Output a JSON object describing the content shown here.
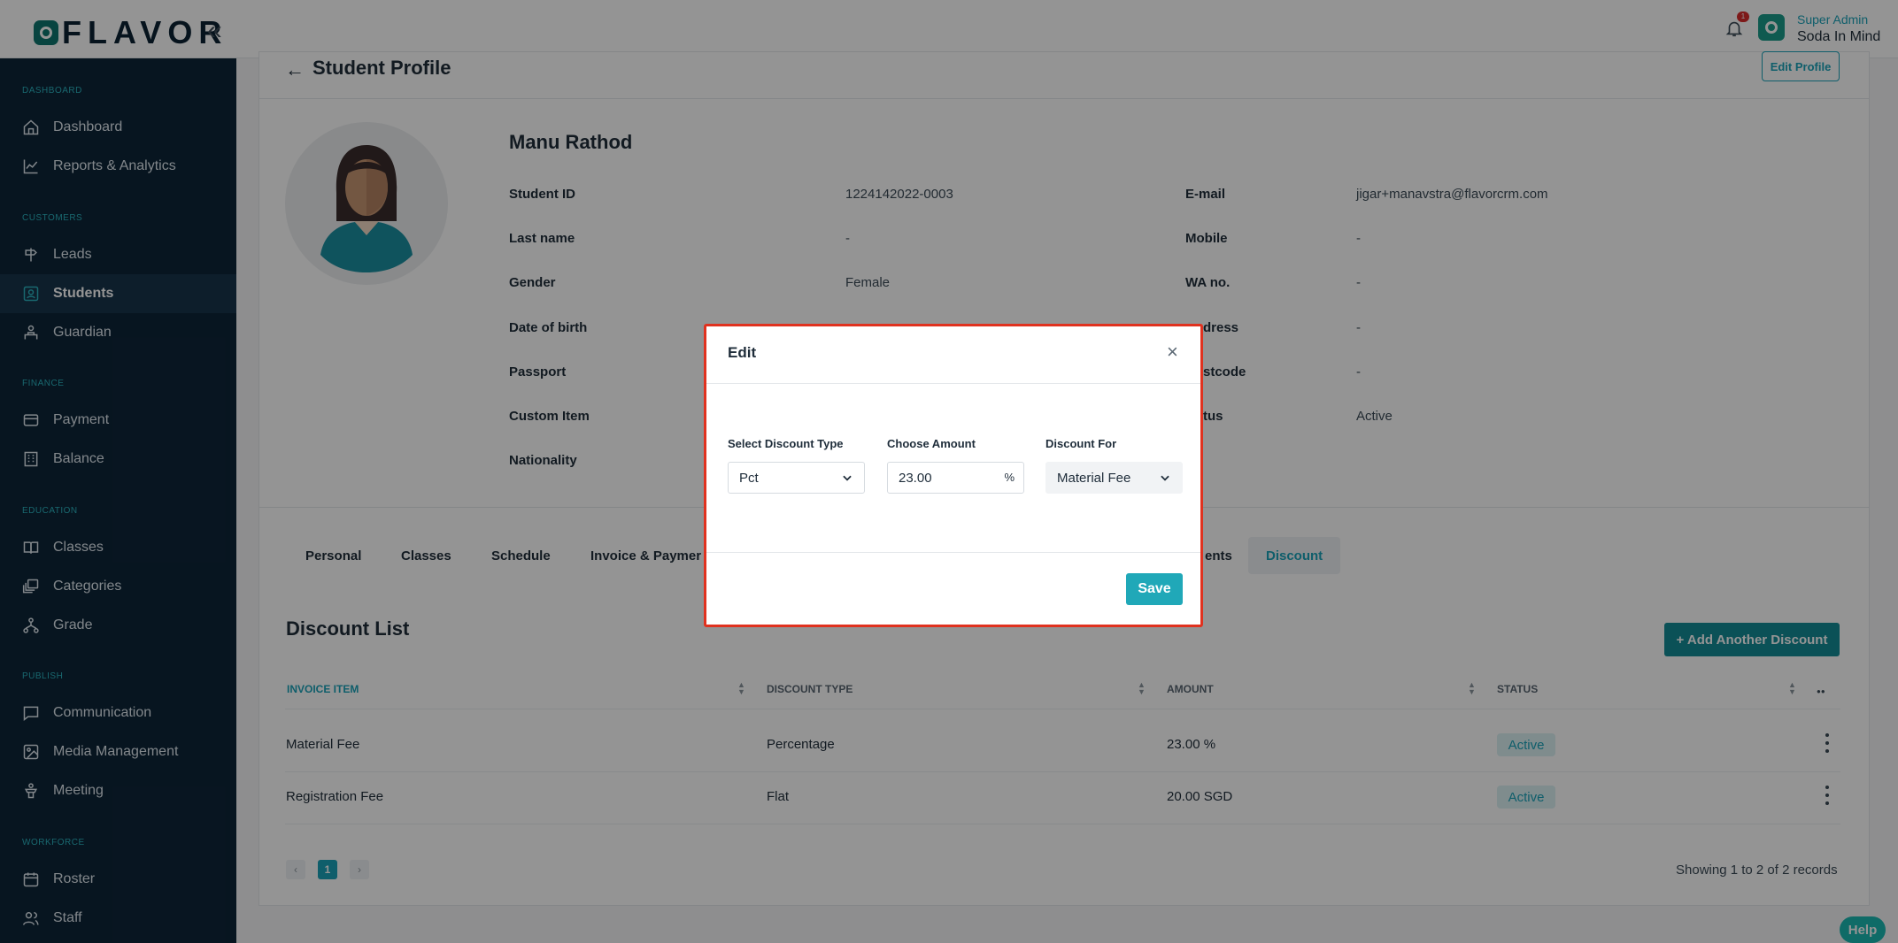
{
  "brand": {
    "logo_text": "FLAVOR",
    "brand_color": "#0f766e"
  },
  "header": {
    "notification_count": "1",
    "user_role": "Super Admin",
    "user_name": "Soda In Mind"
  },
  "sidebar": {
    "sections": [
      {
        "title": "DASHBOARD"
      },
      {
        "title": "CUSTOMERS"
      },
      {
        "title": "FINANCE"
      },
      {
        "title": "EDUCATION"
      },
      {
        "title": "PUBLISH"
      },
      {
        "title": "WORKFORCE"
      }
    ],
    "items": [
      {
        "label": "Dashboard",
        "icon": "home-icon"
      },
      {
        "label": "Reports & Analytics",
        "icon": "chart-line-icon"
      },
      {
        "label": "Leads",
        "icon": "signpost-icon"
      },
      {
        "label": "Students",
        "icon": "student-icon",
        "active": true
      },
      {
        "label": "Guardian",
        "icon": "guardian-icon"
      },
      {
        "label": "Payment",
        "icon": "credit-card-icon"
      },
      {
        "label": "Balance",
        "icon": "building-icon"
      },
      {
        "label": "Classes",
        "icon": "book-icon"
      },
      {
        "label": "Categories",
        "icon": "layers-icon"
      },
      {
        "label": "Grade",
        "icon": "hierarchy-icon"
      },
      {
        "label": "Communication",
        "icon": "message-icon"
      },
      {
        "label": "Media Management",
        "icon": "image-icon"
      },
      {
        "label": "Meeting",
        "icon": "podium-icon"
      },
      {
        "label": "Roster",
        "icon": "calendar-icon"
      },
      {
        "label": "Staff",
        "icon": "users-icon"
      }
    ]
  },
  "page": {
    "title": "Student Profile",
    "edit_profile_label": "Edit Profile"
  },
  "profile": {
    "name": "Manu Rathod",
    "left_fields": [
      {
        "label": "Student ID",
        "value": "1224142022-0003"
      },
      {
        "label": "Last name",
        "value": "-"
      },
      {
        "label": "Gender",
        "value": "Female"
      },
      {
        "label": "Date of birth",
        "value": ""
      },
      {
        "label": "Passport",
        "value": ""
      },
      {
        "label": "Custom Item",
        "value": ""
      },
      {
        "label": "Nationality",
        "value": ""
      }
    ],
    "right_fields": [
      {
        "label": "E-mail",
        "value": "jigar+manavstra@flavorcrm.com"
      },
      {
        "label": "Mobile",
        "value": "-"
      },
      {
        "label": "WA no.",
        "value": "-"
      },
      {
        "label": "dress",
        "value": "-"
      },
      {
        "label": "stcode",
        "value": "-"
      },
      {
        "label": "tus",
        "value": "Active"
      }
    ]
  },
  "tabs": [
    {
      "label": "Personal"
    },
    {
      "label": "Classes"
    },
    {
      "label": "Schedule"
    },
    {
      "label": "Invoice & Paymer"
    },
    {
      "label": "ents"
    },
    {
      "label": "Discount",
      "active": true
    }
  ],
  "discount_list": {
    "title": "Discount List",
    "add_label": "+ Add Another Discount",
    "columns": [
      "INVOICE ITEM",
      "DISCOUNT TYPE",
      "AMOUNT",
      "STATUS"
    ],
    "rows": [
      {
        "item": "Material Fee",
        "type": "Percentage",
        "amount": "23.00 %",
        "status": "Active"
      },
      {
        "item": "Registration Fee",
        "type": "Flat",
        "amount": "20.00 SGD",
        "status": "Active"
      }
    ],
    "pagination": {
      "prev": "‹",
      "current": "1",
      "next": "›",
      "records": "Showing 1 to 2 of 2 records"
    }
  },
  "help_label": "Help",
  "modal": {
    "title": "Edit",
    "close": "×",
    "discount_type_label": "Select Discount Type",
    "discount_type_value": "Pct",
    "amount_label": "Choose Amount",
    "amount_value": "23.00",
    "amount_unit": "%",
    "discount_for_label": "Discount For",
    "discount_for_value": "Material Fee",
    "save_label": "Save"
  },
  "colors": {
    "accent": "#1aa2b8",
    "sidebar_bg": "#0d2538",
    "modal_border": "#e0321f",
    "danger": "#d72b2b"
  }
}
